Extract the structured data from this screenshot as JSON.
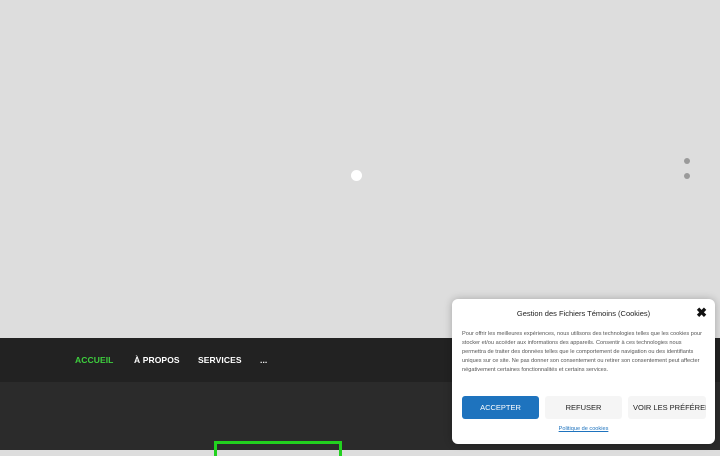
{
  "navigation": {
    "items": [
      {
        "label": "ACCUEIL",
        "active": true
      },
      {
        "label": "À PROPOS",
        "active": false
      },
      {
        "label": "SERVICES",
        "active": false
      },
      {
        "label": "...",
        "active": false
      }
    ]
  },
  "cookie_banner": {
    "title": "Gestion des Fichiers Témoins (Cookies)",
    "close_symbol": "✖",
    "body": "Pour offrir les meilleures expériences, nous utilisons des technologies telles que les cookies pour stocker et/ou accéder aux informations des appareils. Consentir à ces technologies nous permettra de traiter des données telles que le comportement de navigation ou des identifiants uniques sur ce site. Ne pas donner son consentement ou retirer son consentement peut affecter négativement certaines fonctionnalités et certains services.",
    "accept_label": "ACCEPTER",
    "refuse_label": "REFUSER",
    "preferences_label": "VOIR LES PRÉFÉRENCES",
    "policy_link": "Politique de cookies"
  },
  "colors": {
    "active_nav": "#3ecf3e",
    "accent_green": "#22d11f",
    "accept_button": "#1e73be",
    "navbar_bg": "#222222"
  }
}
